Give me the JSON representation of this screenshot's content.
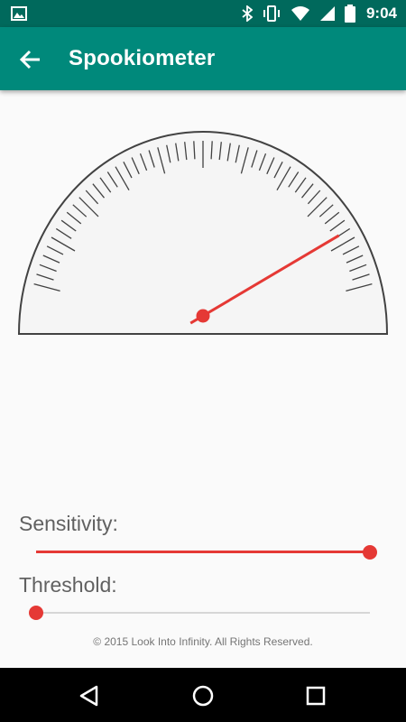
{
  "status_bar": {
    "time": "9:04",
    "icons": [
      "image-notification-icon",
      "bluetooth-icon",
      "vibrate-icon",
      "wifi-icon",
      "cellular-signal-icon",
      "battery-icon"
    ]
  },
  "app_bar": {
    "title": "Spookiometer",
    "back_icon": "arrow-back-icon"
  },
  "gauge": {
    "min": 0,
    "max": 1,
    "needle_value": 0.83,
    "needle_color": "#e53935",
    "dial_color": "#f5f5f5"
  },
  "controls": {
    "sensitivity": {
      "label": "Sensitivity:",
      "value": 1.0
    },
    "threshold": {
      "label": "Threshold:",
      "value": 0.0
    }
  },
  "footer": {
    "copyright": "© 2015 Look Into Infinity. All Rights Reserved."
  },
  "nav_bar": {
    "icons": [
      "back-triangle-icon",
      "home-circle-icon",
      "recents-square-icon"
    ]
  },
  "colors": {
    "status_bar": "#00695c",
    "app_bar": "#00897b",
    "accent": "#e53935"
  }
}
